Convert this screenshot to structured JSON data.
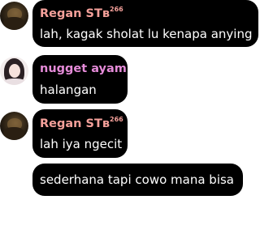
{
  "messages": [
    {
      "sender": "Regan STʙ",
      "badge": "266",
      "name_color": "#f4a09a",
      "text": "lah, kagak sholat lu kenapa anying",
      "avatar": "dark-avatar"
    },
    {
      "sender": "nugget ayam",
      "name_color": "#e58bd8",
      "text": "halangan",
      "avatar": "girl-avatar"
    },
    {
      "sender": "Regan STʙ",
      "badge": "266",
      "name_color": "#f4a09a",
      "text": "lah iya ngecit",
      "avatar": "dark-avatar"
    },
    {
      "text": "sederhana tapi cowo mana bisa"
    }
  ]
}
